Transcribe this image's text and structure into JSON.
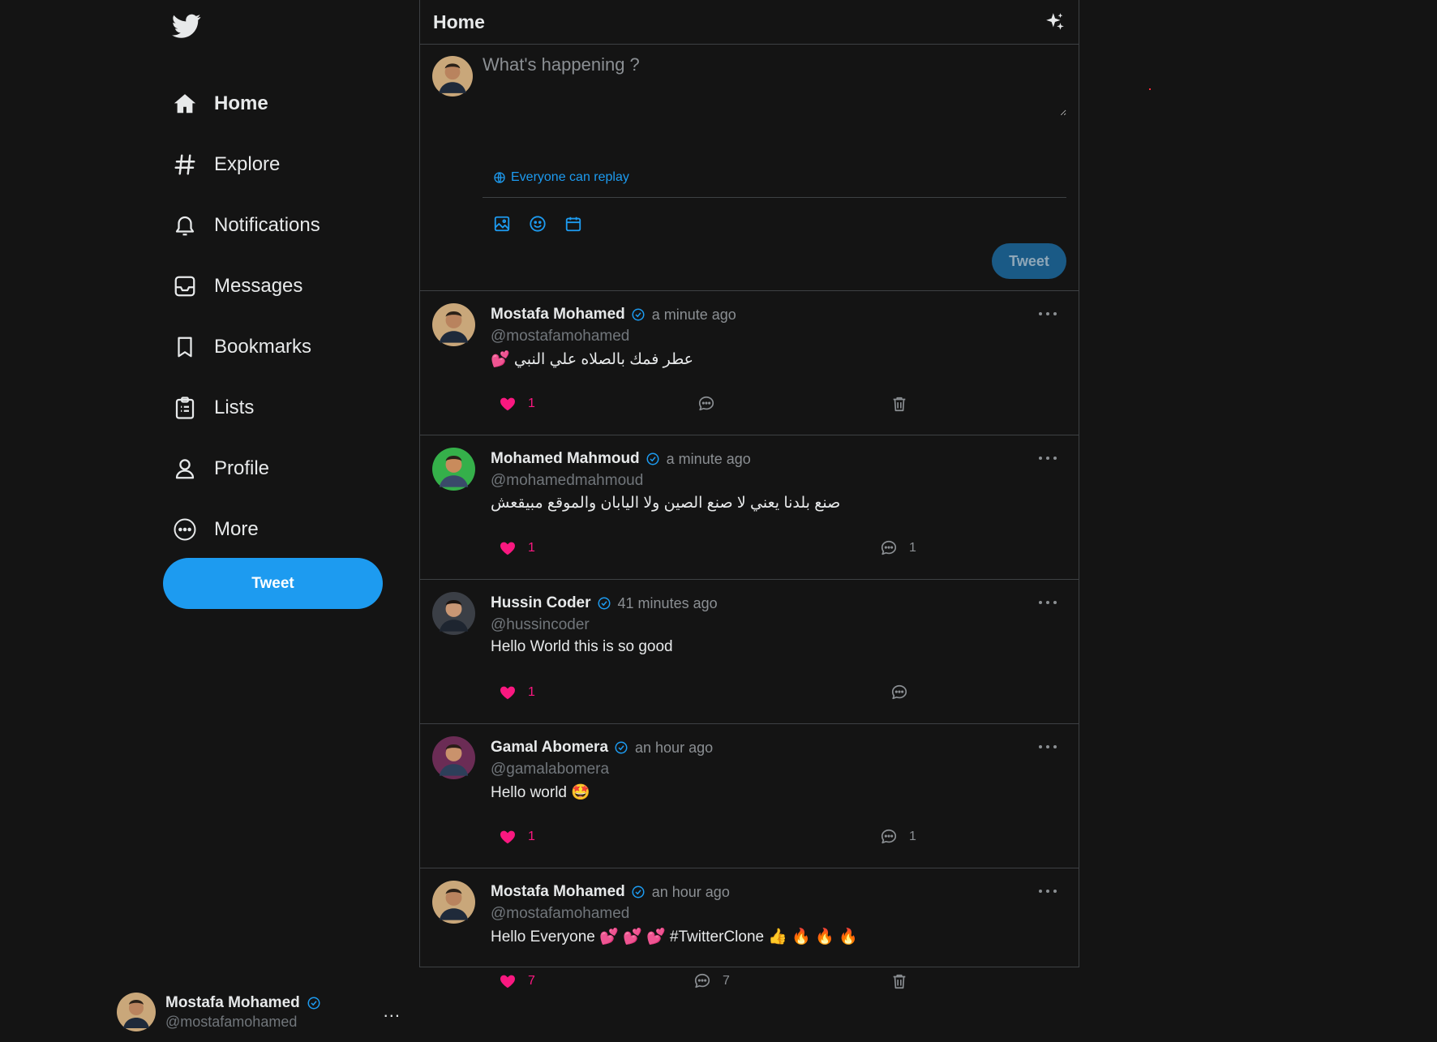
{
  "colors": {
    "accent": "#1d9bf0",
    "like": "#f91880",
    "background": "#141414",
    "border": "#3e4144",
    "muted": "#71767b"
  },
  "sidebar": {
    "logo": "twitter-bird-icon",
    "items": [
      {
        "label": "Home",
        "icon": "home-icon",
        "active": true
      },
      {
        "label": "Explore",
        "icon": "hashtag-icon"
      },
      {
        "label": "Notifications",
        "icon": "bell-icon"
      },
      {
        "label": "Messages",
        "icon": "inbox-icon"
      },
      {
        "label": "Bookmarks",
        "icon": "bookmark-icon"
      },
      {
        "label": "Lists",
        "icon": "clipboard-list-icon"
      },
      {
        "label": "Profile",
        "icon": "user-icon"
      },
      {
        "label": "More",
        "icon": "more-circle-icon"
      }
    ],
    "tweet_label": "Tweet",
    "account": {
      "name": "Mostafa Mohamed",
      "handle": "@mostafamohamed",
      "menu": "..."
    }
  },
  "header": {
    "title": "Home",
    "icon": "sparkle-icon"
  },
  "composer": {
    "placeholder": "What's happening ?",
    "reply_setting": "Everyone can replay",
    "tools": [
      "image-icon",
      "emoji-icon",
      "calendar-icon"
    ],
    "tweet_label": "Tweet"
  },
  "posts": [
    {
      "name": "Mostafa Mohamed",
      "time": "a minute ago",
      "handle": "@mostafamohamed",
      "text": "عطر فمك بالصلاه علي النبي 💕",
      "rtl": true,
      "likes": "1",
      "comments": "",
      "deletable": true
    },
    {
      "name": "Mohamed Mahmoud",
      "time": "a minute ago",
      "handle": "@mohamedmahmoud",
      "text": "صنع بلدنا يعني لا صنع الصين ولا اليابان والموقع مبيقعش",
      "rtl": true,
      "likes": "1",
      "comments": "1",
      "deletable": false
    },
    {
      "name": "Hussin Coder",
      "time": "41 minutes ago",
      "handle": "@hussincoder",
      "text": "Hello World this is so good",
      "rtl": false,
      "likes": "1",
      "comments": "",
      "deletable": false
    },
    {
      "name": "Gamal Abomera",
      "time": "an hour ago",
      "handle": "@gamalabomera",
      "text": "Hello world 🤩",
      "rtl": false,
      "likes": "1",
      "comments": "1",
      "deletable": false
    },
    {
      "name": "Mostafa Mohamed",
      "time": "an hour ago",
      "handle": "@mostafamohamed",
      "text": "Hello Everyone 💕 💕 💕 #TwitterClone 👍 🔥 🔥 🔥",
      "rtl": false,
      "likes": "7",
      "comments": "7",
      "deletable": true
    }
  ]
}
